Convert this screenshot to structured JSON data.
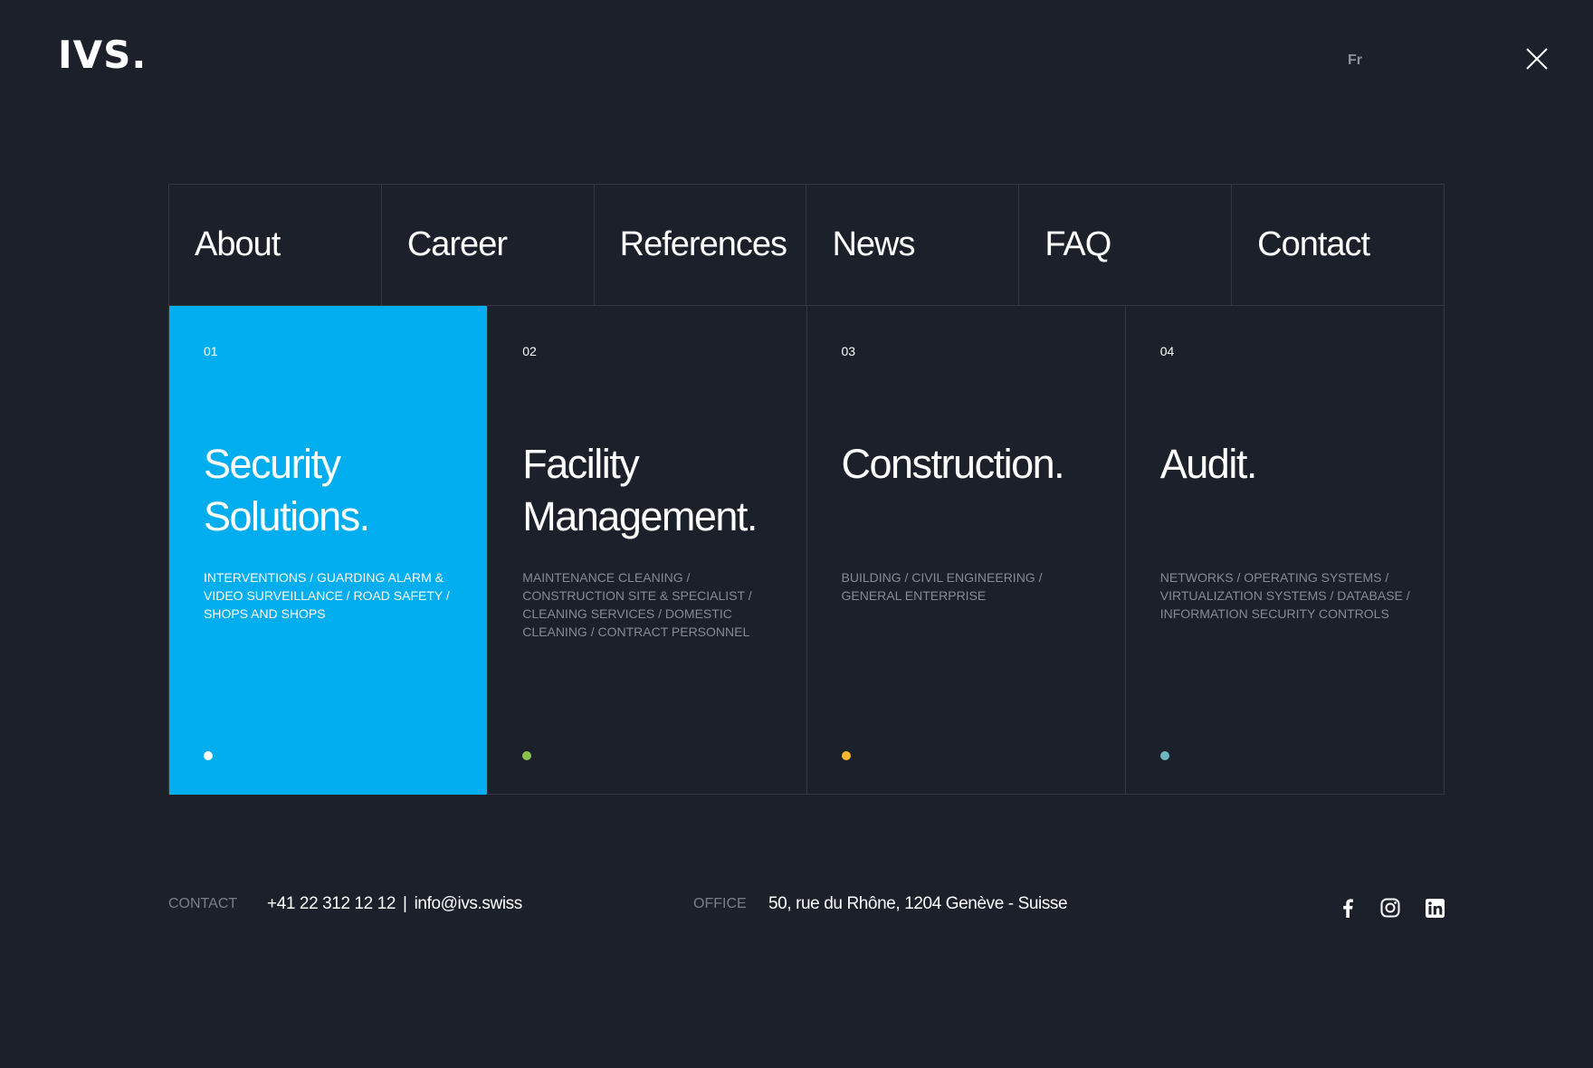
{
  "header": {
    "logo": "IVS.",
    "lang": "Fr"
  },
  "nav": [
    {
      "label": "About"
    },
    {
      "label": "Career"
    },
    {
      "label": "References"
    },
    {
      "label": "News"
    },
    {
      "label": "FAQ"
    },
    {
      "label": "Contact"
    }
  ],
  "cards": [
    {
      "num": "01",
      "title": "Security Solutions.",
      "desc": "Interventions / Guarding alarm & video surveillance / Road safety / Shops and shops",
      "dot_color": "#ffffff",
      "active": true
    },
    {
      "num": "02",
      "title": "Facility Management.",
      "desc": "Maintenance cleaning / Construction site & specialist / Cleaning services / Domestic cleaning  / Contract personnel",
      "dot_color": "#8bc34a",
      "active": false
    },
    {
      "num": "03",
      "title": "Construction.",
      "desc": "Building / Civil engineering / General enterprise",
      "dot_color": "#fbb72c",
      "active": false
    },
    {
      "num": "04",
      "title": "Audit.",
      "desc": "Networks / Operating systems / Virtualization systems / Database / Information security controls",
      "dot_color": "#6fb8c2",
      "active": false
    }
  ],
  "footer": {
    "contact_label": "Contact",
    "phone": "+41 22 312 12 12",
    "separator": "|",
    "email": "info@ivs.swiss",
    "office_label": "Office",
    "address": "50, rue du Rhône, 1204 Genève - Suisse",
    "social": [
      "facebook-icon",
      "instagram-icon",
      "linkedin-icon"
    ]
  },
  "colors": {
    "background": "#1b202a",
    "accent": "#00adef",
    "border": "#313844"
  }
}
